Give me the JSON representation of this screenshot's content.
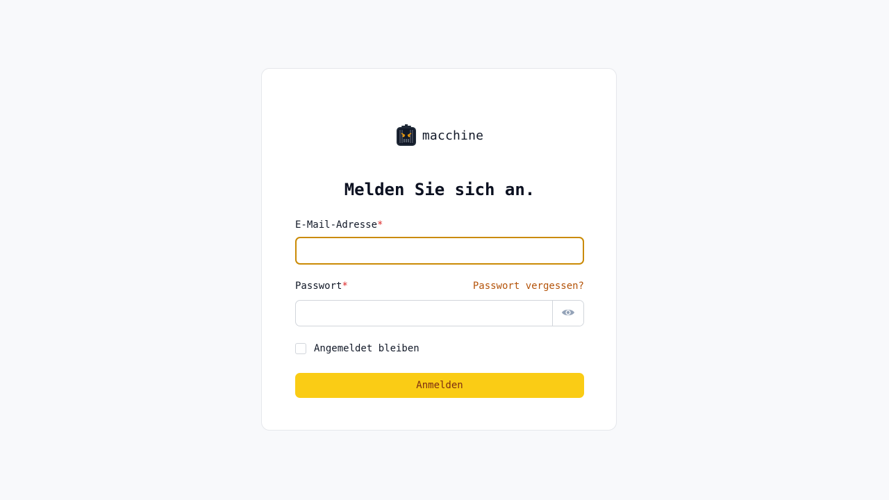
{
  "brand": {
    "name": "macchine",
    "logo_icon": "robot-face-icon"
  },
  "page": {
    "title": "Melden Sie sich an."
  },
  "email": {
    "label": "E-Mail-Adresse",
    "required_mark": "*",
    "value": "",
    "placeholder": ""
  },
  "password": {
    "label": "Passwort",
    "required_mark": "*",
    "forgot_link": "Passwort vergessen?",
    "value": "",
    "toggle_icon": "eye-icon"
  },
  "remember": {
    "label": "Angemeldet bleiben",
    "checked": false
  },
  "submit": {
    "label": "Anmelden"
  },
  "colors": {
    "background": "#f8f9fb",
    "accent": "#facc15",
    "focus_border": "#ca8a04",
    "link": "#b45309",
    "required": "#dc2626"
  }
}
